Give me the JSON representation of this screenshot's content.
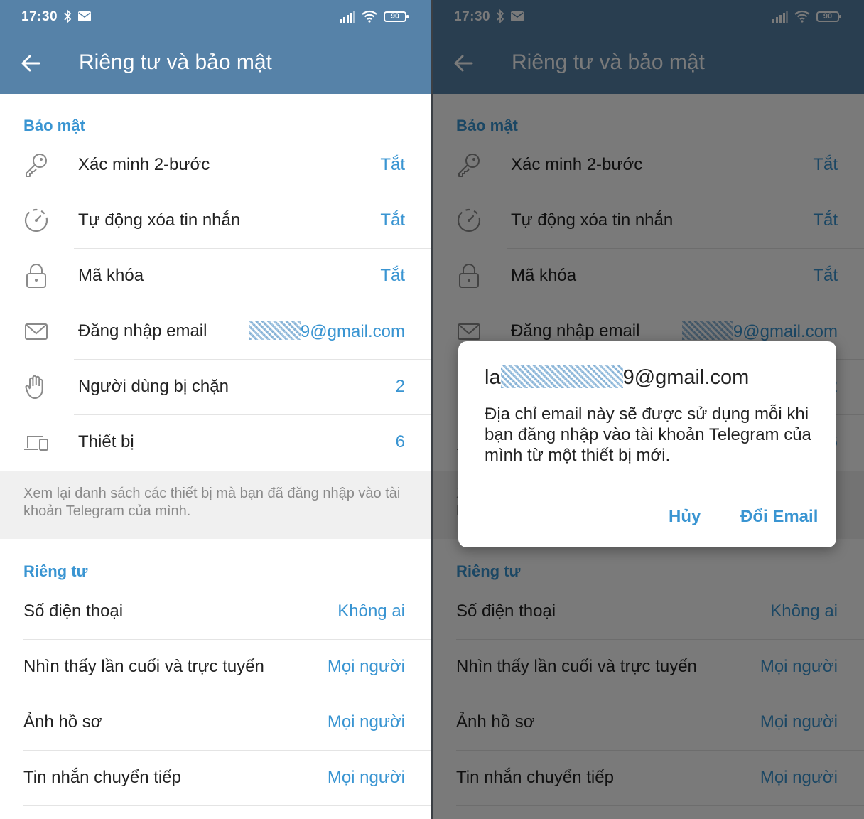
{
  "status": {
    "time": "17:30",
    "battery": "90"
  },
  "header": {
    "title": "Riêng tư và bảo mật"
  },
  "security": {
    "header": "Bảo mật",
    "rows": [
      {
        "label": "Xác minh 2-bước",
        "value": "Tắt",
        "icon": "key-icon"
      },
      {
        "label": "Tự động xóa tin nhắn",
        "value": "Tắt",
        "icon": "timer-icon"
      },
      {
        "label": "Mã khóa",
        "value": "Tắt",
        "icon": "lock-icon"
      },
      {
        "label": "Đăng nhập email",
        "value": "9@gmail.com",
        "icon": "mail-icon"
      },
      {
        "label": "Người dùng bị chặn",
        "value": "2",
        "icon": "hand-icon"
      },
      {
        "label": "Thiết bị",
        "value": "6",
        "icon": "devices-icon"
      }
    ],
    "footer": "Xem lại danh sách các thiết bị mà bạn đã đăng nhập vào tài khoản Telegram của mình."
  },
  "privacy": {
    "header": "Riêng tư",
    "rows": [
      {
        "label": "Số điện thoại",
        "value": "Không ai"
      },
      {
        "label": "Nhìn thấy lần cuối và trực tuyến",
        "value": "Mọi người"
      },
      {
        "label": "Ảnh hồ sơ",
        "value": "Mọi người"
      },
      {
        "label": "Tin nhắn chuyển tiếp",
        "value": "Mọi người"
      }
    ]
  },
  "dialog": {
    "title_prefix": "la",
    "title_suffix": "9@gmail.com",
    "message": "Địa chỉ email này sẽ được sử dụng mỗi khi bạn đăng nhập vào tài khoản Telegram của mình từ một thiết bị mới.",
    "cancel": "Hủy",
    "confirm": "Đổi Email"
  },
  "colors": {
    "appbar": "#5682a8",
    "accent": "#3a95d2",
    "scrim": "rgba(0,0,0,0.52)"
  }
}
